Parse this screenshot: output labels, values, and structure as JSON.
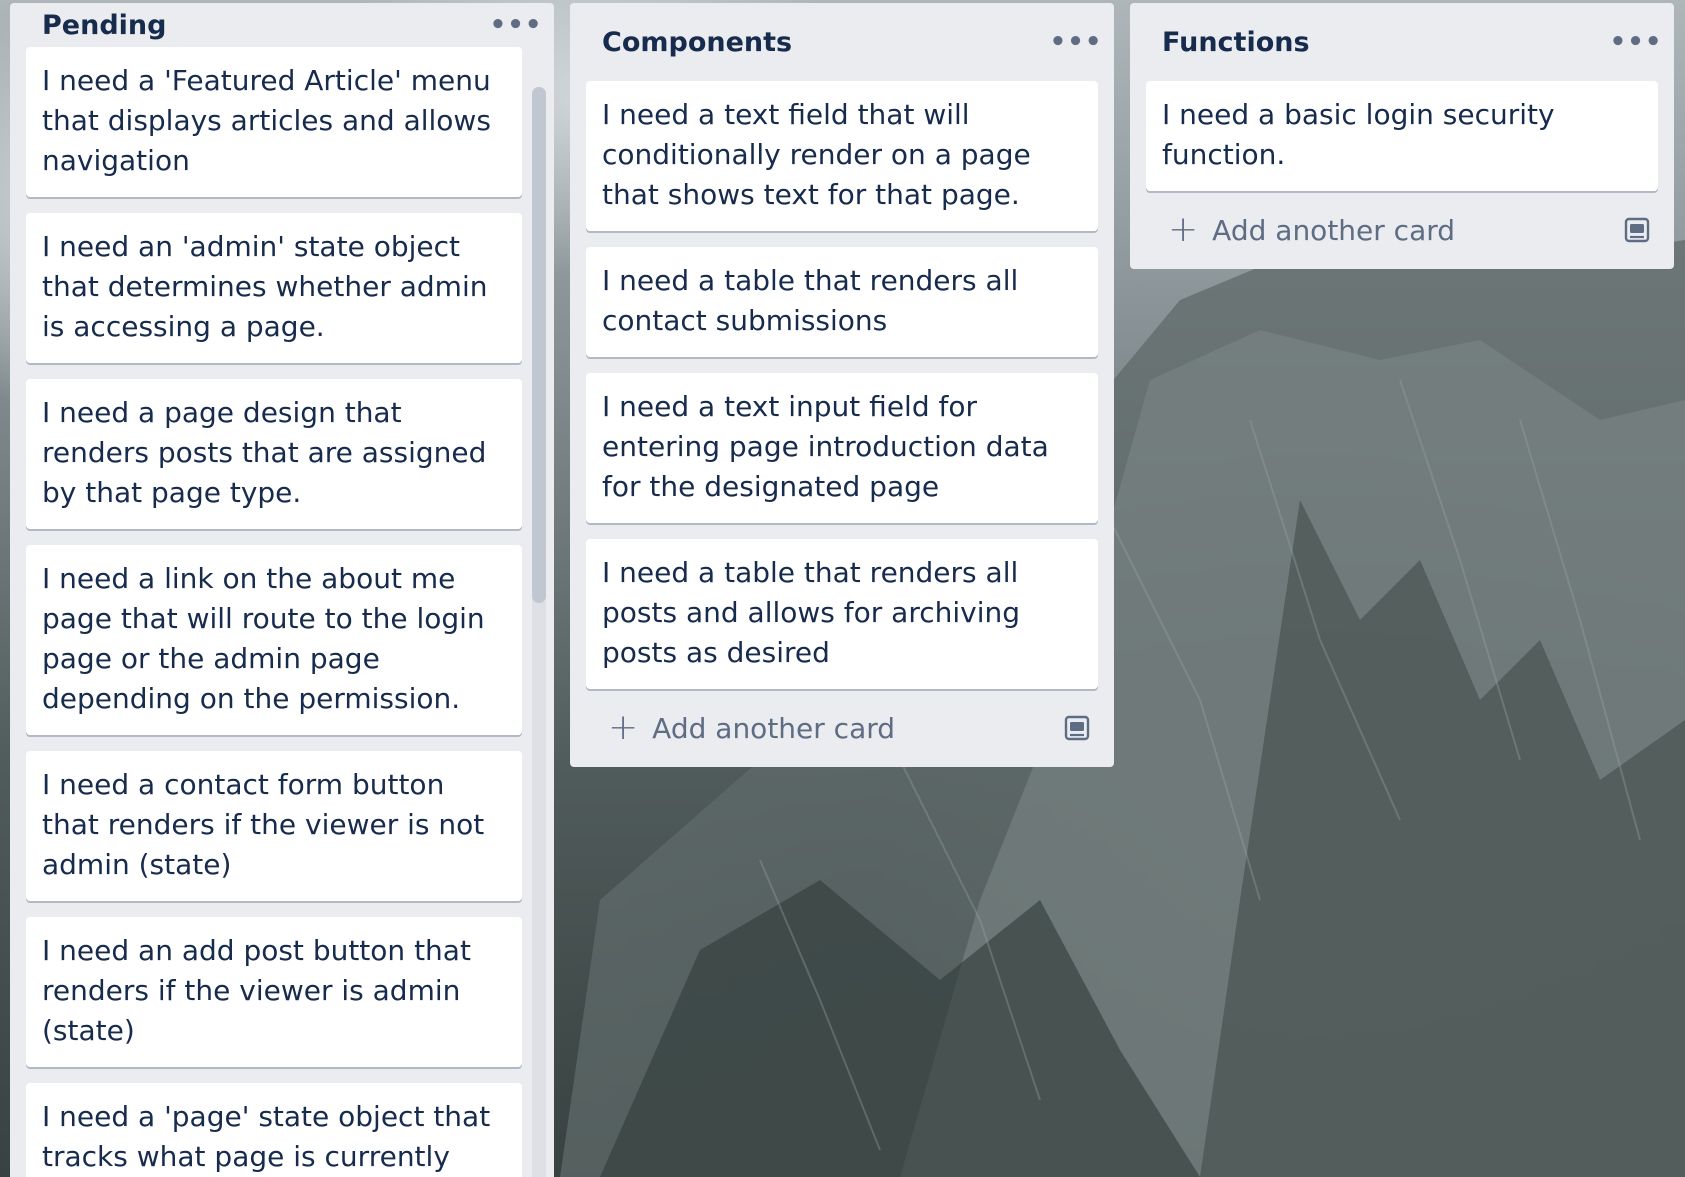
{
  "lists": [
    {
      "title": "Pending",
      "cards": [
        "I need a 'Featured Article' menu that displays articles and allows navigation",
        "I need an 'admin' state object that determines whether admin is accessing a page.",
        "I need a page design that renders posts that are assigned by that page type.",
        "I need a link on the about me page that will route to the login page or the admin page depending on the permission.",
        "I need a contact form button that renders if the viewer is not admin (state)",
        "I need an add post button that renders if the viewer is admin (state)",
        "I need a 'page' state object that tracks what page is currently rendered"
      ]
    },
    {
      "title": "Components",
      "cards": [
        "I need a text field that will conditionally render on a page that shows text for that page.",
        "I need a table that renders all contact submissions",
        "I need a text input field for entering page introduction data for the designated page",
        "I need a table that renders all posts and allows for archiving posts as desired"
      ],
      "add_label": "Add another card"
    },
    {
      "title": "Functions",
      "cards": [
        "I need a basic login security function."
      ],
      "add_label": "Add another card"
    }
  ],
  "icons": {
    "menu": "more-horizontal-icon",
    "add": "plus-icon",
    "template": "card-template-icon"
  },
  "colors": {
    "list_bg": "#ebecf0",
    "card_bg": "#ffffff",
    "title_text": "#172b4d",
    "muted_text": "#5e6c84"
  }
}
